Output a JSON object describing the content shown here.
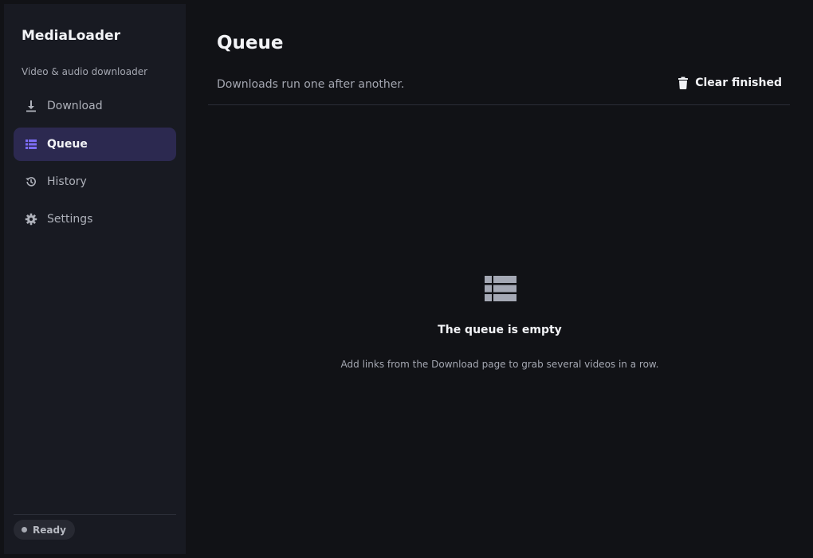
{
  "sidebar": {
    "app_title": "MediaLoader",
    "app_subtitle": "Video & audio downloader",
    "items": [
      {
        "label": "Download",
        "icon": "download-icon",
        "active": false
      },
      {
        "label": "Queue",
        "icon": "list-icon",
        "active": true
      },
      {
        "label": "History",
        "icon": "history-icon",
        "active": false
      },
      {
        "label": "Settings",
        "icon": "gear-icon",
        "active": false
      }
    ],
    "status": {
      "label": "Ready",
      "icon": "status-dot-icon"
    }
  },
  "main": {
    "title": "Queue",
    "subtitle": "Downloads run one after another.",
    "clear_button": {
      "label": "Clear finished",
      "icon": "trash-icon"
    },
    "empty_state": {
      "icon": "list-icon",
      "title": "The queue is empty",
      "text": "Add links from the Download page to grab several videos in a row."
    }
  },
  "colors": {
    "background": "#111216",
    "sidebar": "#181a22",
    "accent": "#7c6cf5",
    "active_item_bg": "#2c2950",
    "text_primary": "#f2f3f6",
    "text_secondary": "#a4a7b1"
  }
}
